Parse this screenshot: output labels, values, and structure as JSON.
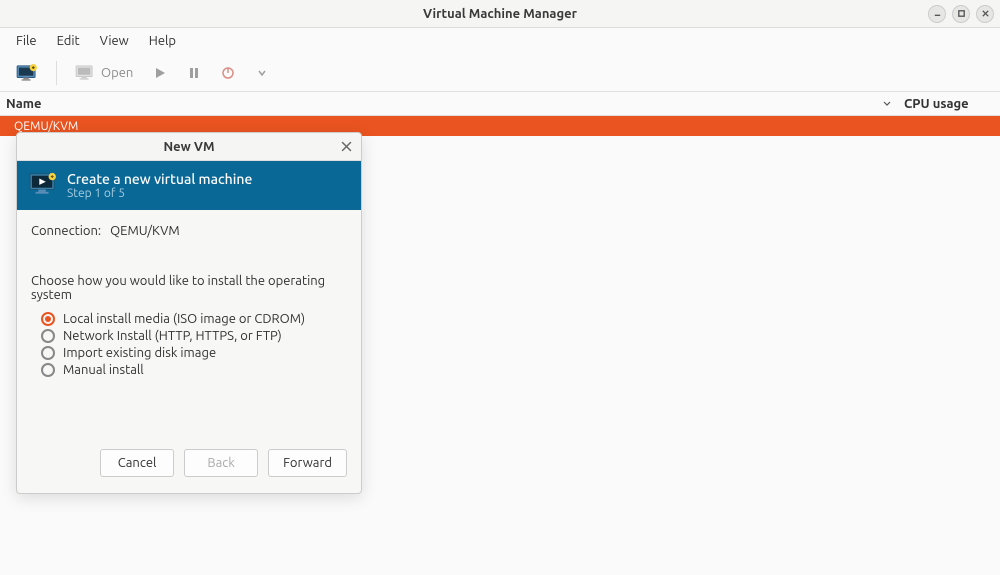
{
  "window": {
    "title": "Virtual Machine Manager"
  },
  "menubar": {
    "items": [
      "File",
      "Edit",
      "View",
      "Help"
    ]
  },
  "toolbar": {
    "open_label": "Open"
  },
  "columns": {
    "name": "Name",
    "cpu": "CPU usage"
  },
  "list": {
    "selected_connection": "QEMU/KVM"
  },
  "dialog": {
    "title": "New VM",
    "header_title": "Create a new virtual machine",
    "header_step": "Step 1 of 5",
    "connection_label": "Connection:",
    "connection_value": "QEMU/KVM",
    "prompt": "Choose how you would like to install the operating system",
    "options": [
      "Local install media (ISO image or CDROM)",
      "Network Install (HTTP, HTTPS, or FTP)",
      "Import existing disk image",
      "Manual install"
    ],
    "selected_option": 0,
    "buttons": {
      "cancel": "Cancel",
      "back": "Back",
      "forward": "Forward"
    }
  }
}
